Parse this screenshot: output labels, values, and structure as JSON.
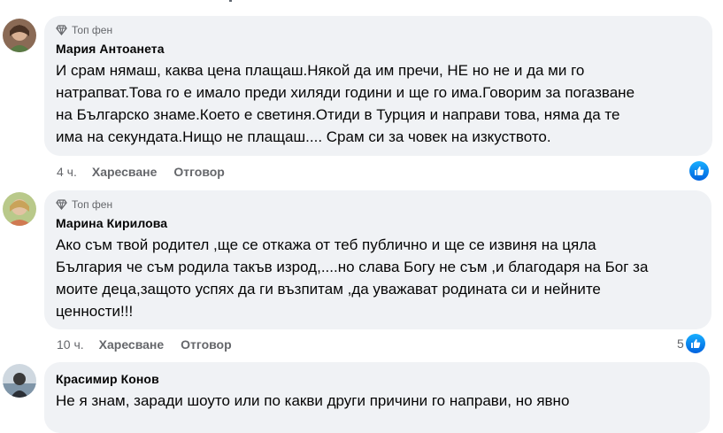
{
  "comments": [
    {
      "badge": "Топ фен",
      "author": "Мария Антоанета",
      "text_lines": [
        "И срам нямаш, каква цена плащаш.Някой да им пречи, НЕ но не и да ми го",
        "натрапват.Това го е имало преди хиляди години и ще го има.Говорим за погазване",
        "на Българско знаме.Което е светиня.Отиди в Турция и направи това, няма да те",
        "има на секундата.Нищо не плащаш.... Срам си за човек на изкуството."
      ],
      "time": "4 ч.",
      "like_label": "Харесване",
      "reply_label": "Отговор",
      "reaction_count": "",
      "reaction_icon": "thumbs-up-icon",
      "avatar_colors": [
        "#7b5e4a",
        "#c9a07c",
        "#4a6b3a"
      ]
    },
    {
      "badge": "Топ фен",
      "author": "Марина Кирилова",
      "text_lines": [
        "Ако съм твой родител ,ще се откажа от теб публично и ще се извиня на цяла",
        "България че съм родила такъв изрод,....но слава Богу не съм ,и благодаря на Бог за",
        "моите деца,защото успях да ги възпитам ,да уважават родината си и нейните",
        "ценности!!!"
      ],
      "time": "10 ч.",
      "like_label": "Харесване",
      "reply_label": "Отговор",
      "reaction_count": "5",
      "reaction_icon": "thumbs-up-icon",
      "avatar_colors": [
        "#d9c59a",
        "#8fb26a",
        "#c48b5b"
      ]
    },
    {
      "badge": "",
      "author": "Красимир Конов",
      "text_lines": [
        "Не я знам, заради шоуто или по какви други причини го направи, но явно"
      ],
      "avatar_colors": [
        "#9bb7d4",
        "#3c4a57",
        "#d8dde2"
      ]
    }
  ],
  "colors": {
    "bubble_bg": "#f0f2f5",
    "meta_text": "#65676b",
    "like_blue": "#0866ff"
  }
}
